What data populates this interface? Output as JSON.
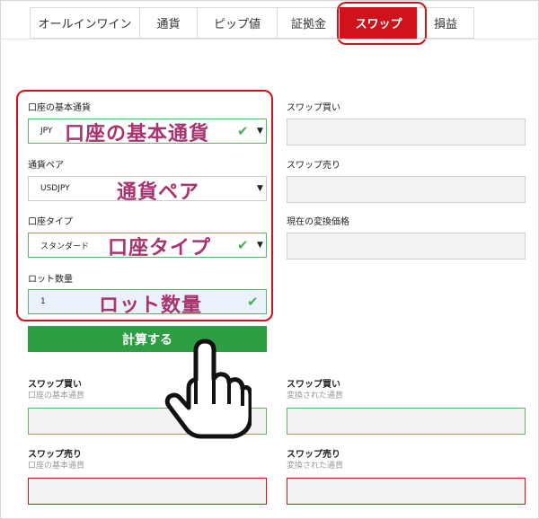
{
  "tabs": [
    {
      "label": "オールインワイン",
      "active": false
    },
    {
      "label": "通貨",
      "active": false
    },
    {
      "label": "ピップ値",
      "active": false
    },
    {
      "label": "証拠金",
      "active": false
    },
    {
      "label": "スワップ",
      "active": true
    },
    {
      "label": "損益",
      "active": false
    }
  ],
  "form": {
    "base_currency": {
      "label": "口座の基本通貨",
      "value": "JPY",
      "annotation": "口座の基本通貨"
    },
    "pair": {
      "label": "通貨ペア",
      "value": "USDJPY",
      "annotation": "通貨ペア"
    },
    "account_type": {
      "label": "口座タイプ",
      "value": "スタンダード",
      "annotation": "口座タイプ"
    },
    "lot": {
      "label": "ロット数量",
      "value": "1",
      "annotation": "ロット数量"
    }
  },
  "right_fields": {
    "swap_buy": "スワップ買い",
    "swap_sell": "スワップ売り",
    "conversion_price": "現在の変換価格"
  },
  "calculate_label": "計算する",
  "results": {
    "swap_buy_base": {
      "label": "スワップ買い",
      "sub": "口座の基本通貨"
    },
    "swap_buy_converted": {
      "label": "スワップ買い",
      "sub": "変換された通貨"
    },
    "swap_sell_base": {
      "label": "スワップ売り",
      "sub": "口座の基本通貨"
    },
    "swap_sell_converted": {
      "label": "スワップ売り",
      "sub": "変換された通貨"
    }
  },
  "colors": {
    "accent_red": "#d0121b",
    "button_green": "#2e9e44",
    "annotation_purple": "#a8336f"
  }
}
